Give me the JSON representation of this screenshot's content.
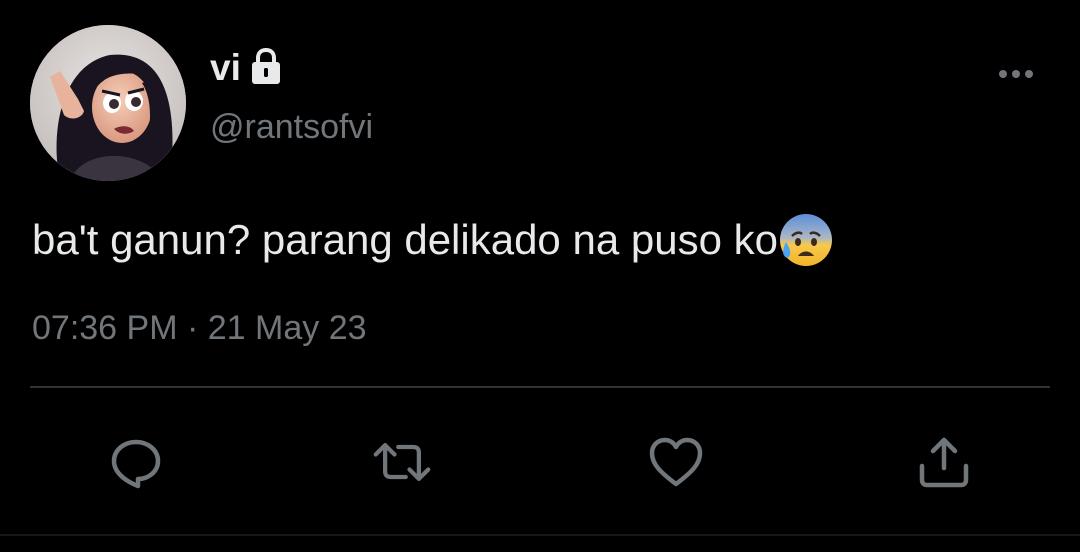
{
  "user": {
    "display_name": "vi",
    "handle": "@rantsofvi",
    "protected_icon": "lock-icon",
    "avatar": "animated-girl-avatar"
  },
  "tweet": {
    "text": "ba't ganun? parang delikado na puso ko",
    "emoji": "anxious-face-with-sweat-emoji"
  },
  "meta": {
    "time": "07:36 PM",
    "separator": "·",
    "date": "21 May 23"
  },
  "menu": {
    "icon": "more-horizontal-icon"
  },
  "actions": [
    {
      "name": "reply",
      "icon": "reply-icon"
    },
    {
      "name": "retweet",
      "icon": "retweet-icon"
    },
    {
      "name": "like",
      "icon": "heart-icon"
    },
    {
      "name": "share",
      "icon": "share-icon"
    }
  ],
  "colors": {
    "background": "#000000",
    "primary_text": "#e7e9ea",
    "secondary_text": "#71767b",
    "divider": "#2f3336"
  }
}
